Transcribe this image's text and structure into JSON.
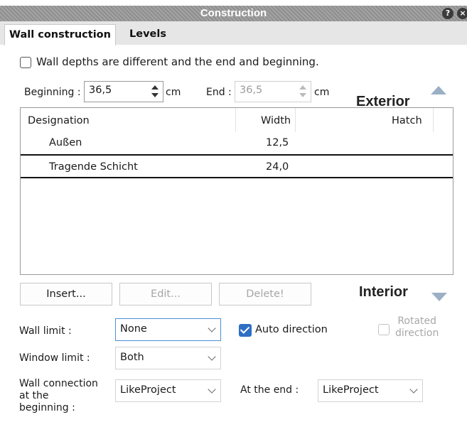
{
  "window": {
    "title": "Construction"
  },
  "tabs": [
    {
      "label": "Wall construction"
    },
    {
      "label": "Levels"
    }
  ],
  "depth_check": {
    "label": "Wall depths are different and the end and beginning.",
    "checked": false
  },
  "beginning": {
    "label": "Beginning :",
    "value": "36,5",
    "unit": "cm"
  },
  "end": {
    "label": "End :",
    "value": "36,5",
    "unit": "cm"
  },
  "sections": {
    "exterior": "Exterior",
    "interior": "Interior"
  },
  "table": {
    "headers": {
      "designation": "Designation",
      "width": "Width",
      "hatch": "Hatch"
    },
    "rows": [
      {
        "designation": "Außen",
        "width": "12,5",
        "hatch": ""
      },
      {
        "designation": "Tragende Schicht",
        "width": "24,0",
        "hatch": ""
      }
    ]
  },
  "buttons": {
    "insert": "Insert...",
    "edit": "Edit...",
    "delete": "Delete!"
  },
  "wall_limit": {
    "label": "Wall limit :",
    "value": "None"
  },
  "auto_direction": {
    "label": "Auto direction",
    "checked": true
  },
  "rotated_direction": {
    "label_line1": "Rotated",
    "label_line2": "direction",
    "checked": false
  },
  "window_limit": {
    "label": "Window limit :",
    "value": "Both"
  },
  "wall_connection": {
    "label_line1": "Wall connection",
    "label_line2": "at the",
    "label_line3": "beginning :",
    "value": "LikeProject"
  },
  "at_the_end": {
    "label": "At the end :",
    "value": "LikeProject"
  },
  "colors": {
    "accent": "#2f6fc4",
    "titlebar": "#9a9a9a",
    "arrow": "#9bb0c5"
  },
  "icons": {
    "help": "help-icon",
    "close": "close-icon",
    "up": "triangle-up-icon",
    "down": "triangle-down-icon"
  }
}
